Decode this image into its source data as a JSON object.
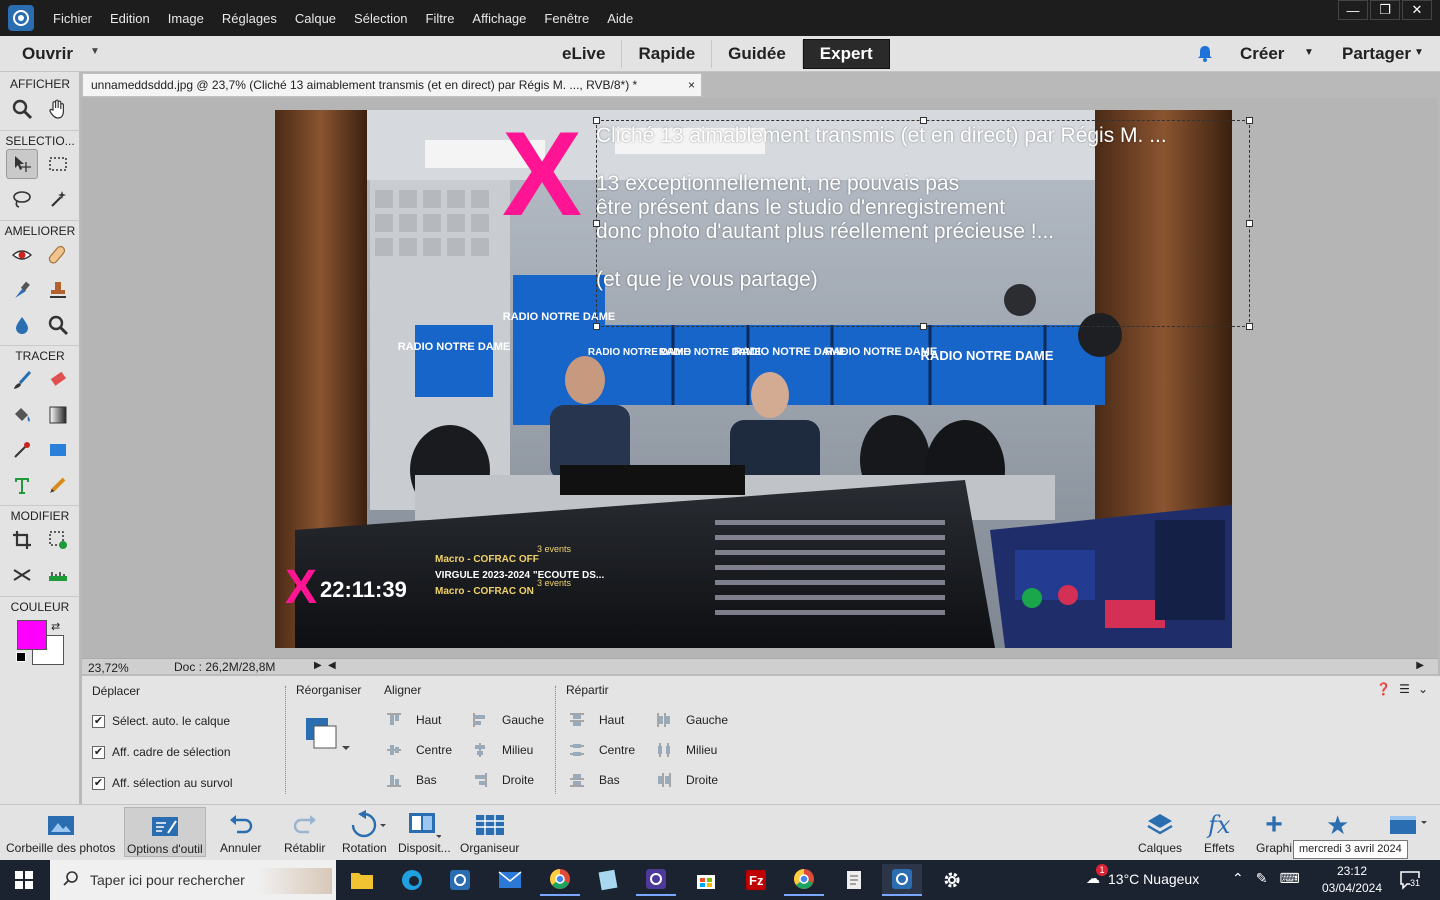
{
  "menu": {
    "items": [
      "Fichier",
      "Edition",
      "Image",
      "Réglages",
      "Calque",
      "Sélection",
      "Filtre",
      "Affichage",
      "Fenêtre",
      "Aide"
    ],
    "window_controls": [
      "—",
      "❐",
      "✕"
    ]
  },
  "modebar": {
    "open_label": "Ouvrir",
    "modes": [
      "eLive",
      "Rapide",
      "Guidée",
      "Expert"
    ],
    "active_mode": "Expert",
    "create_label": "Créer",
    "share_label": "Partager"
  },
  "toolbox": {
    "sections": [
      "AFFICHER",
      "SELECTIO...",
      "AMELIORER",
      "TRACER",
      "MODIFIER",
      "COULEUR"
    ],
    "foreground_color": "#ff00ff",
    "background_color": "#ffffff"
  },
  "document": {
    "tab_title": "unnameddsddd.jpg @ 23,7% (Cliché 13 aimablement transmis (et en direct) par Régis M.   ..., RVB/8*) *",
    "tab_close": "×",
    "overlay_lines": [
      "Cliché 13 aimablement transmis (et en direct) par Régis M.  ...",
      "13 exceptionnellement, ne pouvais pas",
      "être présent dans le studio d'enregistrement",
      "donc photo  d'autant plus réellement précieuse !...",
      "(et que je vous partage)"
    ],
    "x_mark": "X",
    "screen_time": "22:11:39",
    "screen_items": [
      "Macro - COFRAC OFF",
      "VIRGULE 2023-2024 \"ECOUTE DS...",
      "Macro - COFRAC ON"
    ],
    "screen_events": [
      "3 events",
      "3 events"
    ],
    "screen_brand": "RADIO NOTRE DAME",
    "zoom": "23,72%",
    "doc_size": "Doc : 26,2M/28,8M"
  },
  "options": {
    "move_title": "Déplacer",
    "checkboxes": [
      {
        "label": "Sélect. auto. le calque",
        "checked": true
      },
      {
        "label": "Aff. cadre de sélection",
        "checked": true
      },
      {
        "label": "Aff. sélection au survol",
        "checked": true
      }
    ],
    "arrange_title": "Réorganiser",
    "align_title": "Aligner",
    "align_left_col": [
      "Haut",
      "Centre",
      "Bas"
    ],
    "align_right_col": [
      "Gauche",
      "Milieu",
      "Droite"
    ],
    "distribute_title": "Répartir",
    "distribute_left_col": [
      "Haut",
      "Centre",
      "Bas"
    ],
    "distribute_right_col": [
      "Gauche",
      "Milieu",
      "Droite"
    ],
    "check_mark": "✔"
  },
  "bottombar": {
    "left": [
      "Corbeille des photos",
      "Options d'outil",
      "Annuler",
      "Rétablir",
      "Rotation",
      "Disposit...",
      "Organiseur"
    ],
    "right": [
      "Calques",
      "Effets",
      "Graphi"
    ],
    "tooltip": "mercredi 3 avril 2024"
  },
  "taskbar": {
    "search_placeholder": "Taper ici pour rechercher",
    "weather": "13°C  Nuageux",
    "time": "23:12",
    "date": "03/04/2024",
    "notifications": "31",
    "badge": "1"
  }
}
